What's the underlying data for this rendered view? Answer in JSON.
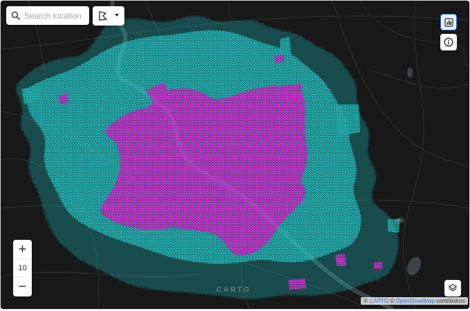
{
  "search": {
    "placeholder": "Search location"
  },
  "zoom": {
    "plus_label": "+",
    "level": "10",
    "minus_label": "−"
  },
  "logo": {
    "text": "CARTO"
  },
  "attribution": {
    "sep1": "© ",
    "carto": "CARTO",
    "sep2": " © ",
    "osm": "OpenStreetMap",
    "suffix": " contributors"
  },
  "icons": {
    "search": "search-icon",
    "draw": "polygon-draw-icon",
    "widgets": "chart-icon",
    "info": "info-icon",
    "layers": "layers-icon"
  },
  "colors": {
    "basemap": "#181818",
    "roads": "#2b2b2b",
    "water": "#3b4448",
    "low_density": "#1fc6c8",
    "high_density": "#e01ad6",
    "accent": "#2f6fe8"
  }
}
